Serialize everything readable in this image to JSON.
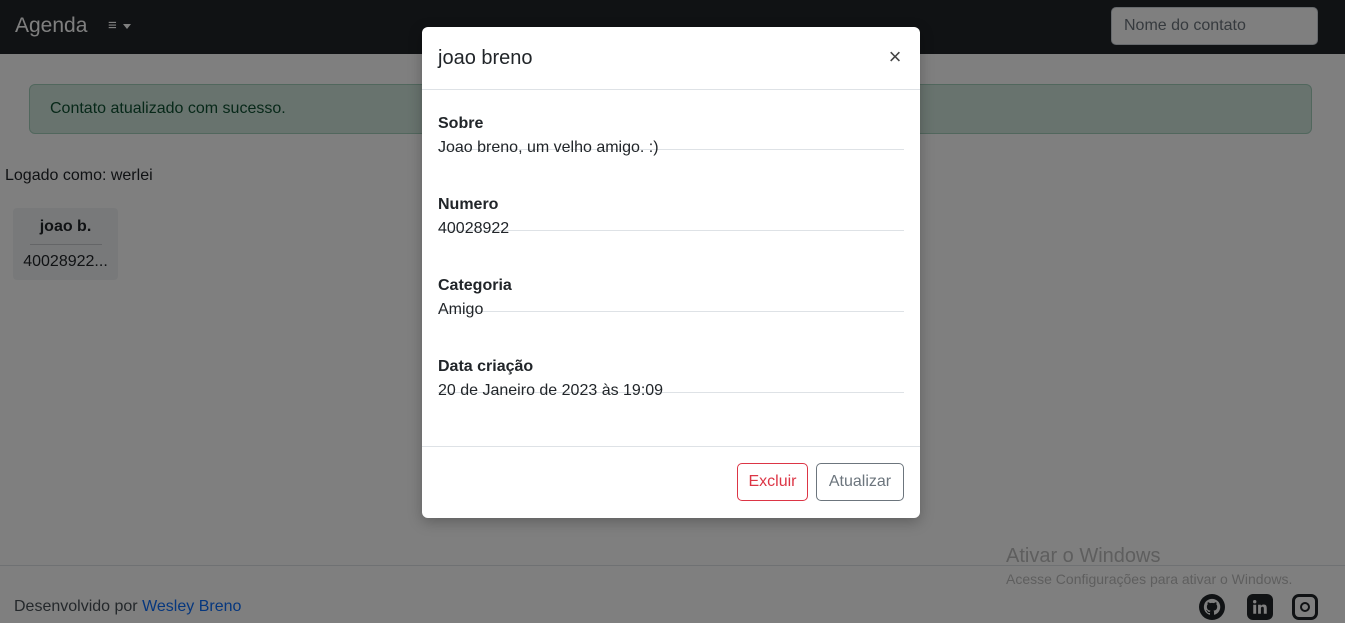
{
  "navbar": {
    "brand": "Agenda",
    "menu_icon": "≡",
    "search_placeholder": "Nome do contato"
  },
  "alert": {
    "text": "Contato atualizado com sucesso."
  },
  "session": {
    "logged_as": "Logado como: werlei"
  },
  "contacts": [
    {
      "name": "joao b.",
      "number": "40028922..."
    }
  ],
  "footer": {
    "prefix": "Desenvolvido por ",
    "author": "Wesley Breno",
    "social": [
      "github-icon",
      "linkedin-icon",
      "instagram-icon"
    ]
  },
  "watermark": {
    "title": "Ativar o Windows",
    "subtitle": "Acesse Configurações para ativar o Windows."
  },
  "modal": {
    "title": "joao breno",
    "close_label": "×",
    "fields": [
      {
        "label": "Sobre",
        "value": "Joao breno, um velho amigo. :)"
      },
      {
        "label": "Numero",
        "value": "40028922"
      },
      {
        "label": "Categoria",
        "value": "Amigo"
      },
      {
        "label": "Data criação",
        "value": "20 de Janeiro de 2023 às 19:09"
      }
    ],
    "delete_label": "Excluir",
    "update_label": "Atualizar"
  },
  "colors": {
    "navbar": "#212529",
    "alert_bg": "#d1e7dd",
    "alert_text": "#0f5132",
    "danger": "#dc3545",
    "secondary": "#6c757d",
    "link": "#0d6efd"
  }
}
